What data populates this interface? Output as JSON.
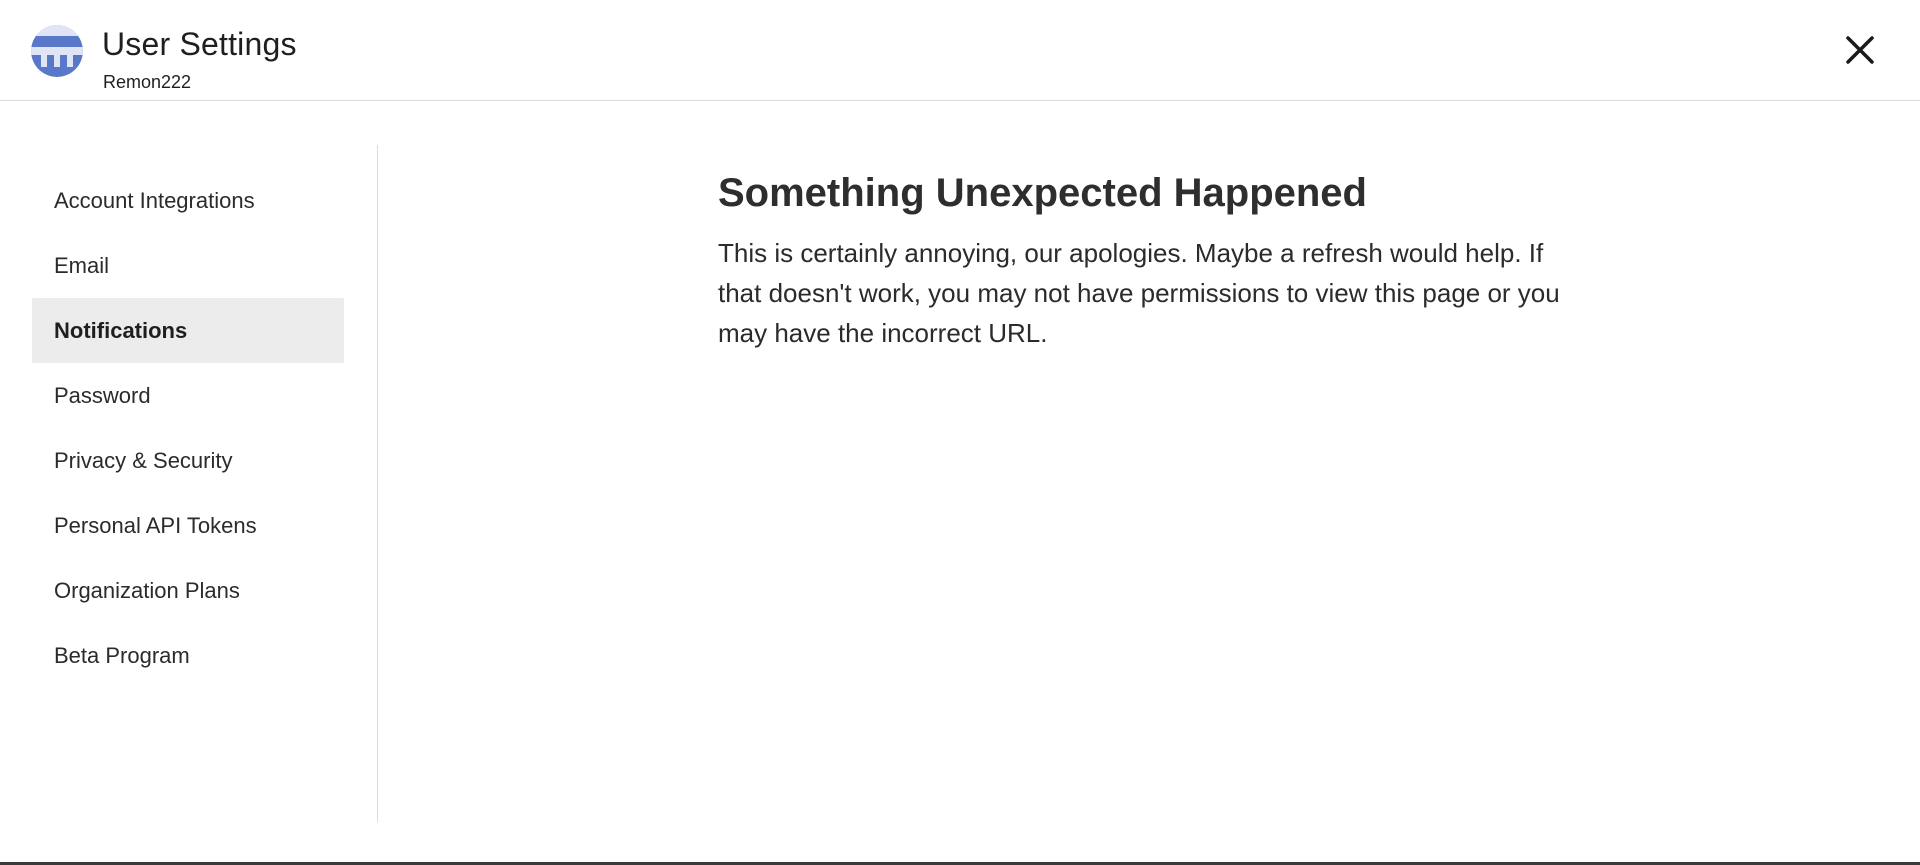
{
  "header": {
    "title": "User Settings",
    "username": "Remon222",
    "avatar_color": "#5a78c9",
    "close_icon": "close-icon"
  },
  "sidebar": {
    "items": [
      {
        "label": "Account Integrations",
        "active": false
      },
      {
        "label": "Email",
        "active": false
      },
      {
        "label": "Notifications",
        "active": true
      },
      {
        "label": "Password",
        "active": false
      },
      {
        "label": "Privacy & Security",
        "active": false
      },
      {
        "label": "Personal API Tokens",
        "active": false
      },
      {
        "label": "Organization Plans",
        "active": false
      },
      {
        "label": "Beta Program",
        "active": false
      }
    ],
    "active_bg": "#ececec"
  },
  "error": {
    "heading": "Something Unexpected Happened",
    "message": "This is certainly annoying, our apologies. Maybe a refresh would help. If that doesn't work, you may not have permissions to view this page or you may have the incorrect URL."
  }
}
